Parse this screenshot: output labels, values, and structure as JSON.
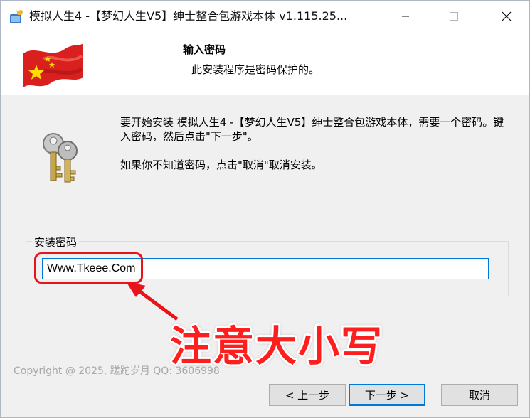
{
  "window": {
    "title": "模拟人生4 -【梦幻人生V5】绅士整合包游戏本体 v1.115.25...",
    "icons": {
      "app": "installer-icon",
      "minimize": "minimize-icon",
      "maximize": "maximize-icon",
      "close": "close-icon"
    }
  },
  "header": {
    "title": "输入密码",
    "subtitle": "此安装程序是密码保护的。",
    "image": "chinese-flag-image"
  },
  "body": {
    "instruction": "要开始安装 模拟人生4 -【梦幻人生V5】绅士整合包游戏本体，需要一个密码。键入密码，然后点击\"下一步\"。",
    "cancel_hint": "如果你不知道密码，点击\"取消\"取消安装。",
    "image": "keys-icon",
    "password_group_label": "安装密码",
    "password_value": "Www.Tkeee.Com",
    "annotation": "注意大小写",
    "copyright": "Copyright @ 2025, 蹉跎岁月 QQ: 3606998"
  },
  "buttons": {
    "back": "< 上一步",
    "next": "下一步 >",
    "cancel": "取消"
  },
  "colors": {
    "accent": "#0078d7",
    "annotation_red": "#e8141b"
  }
}
